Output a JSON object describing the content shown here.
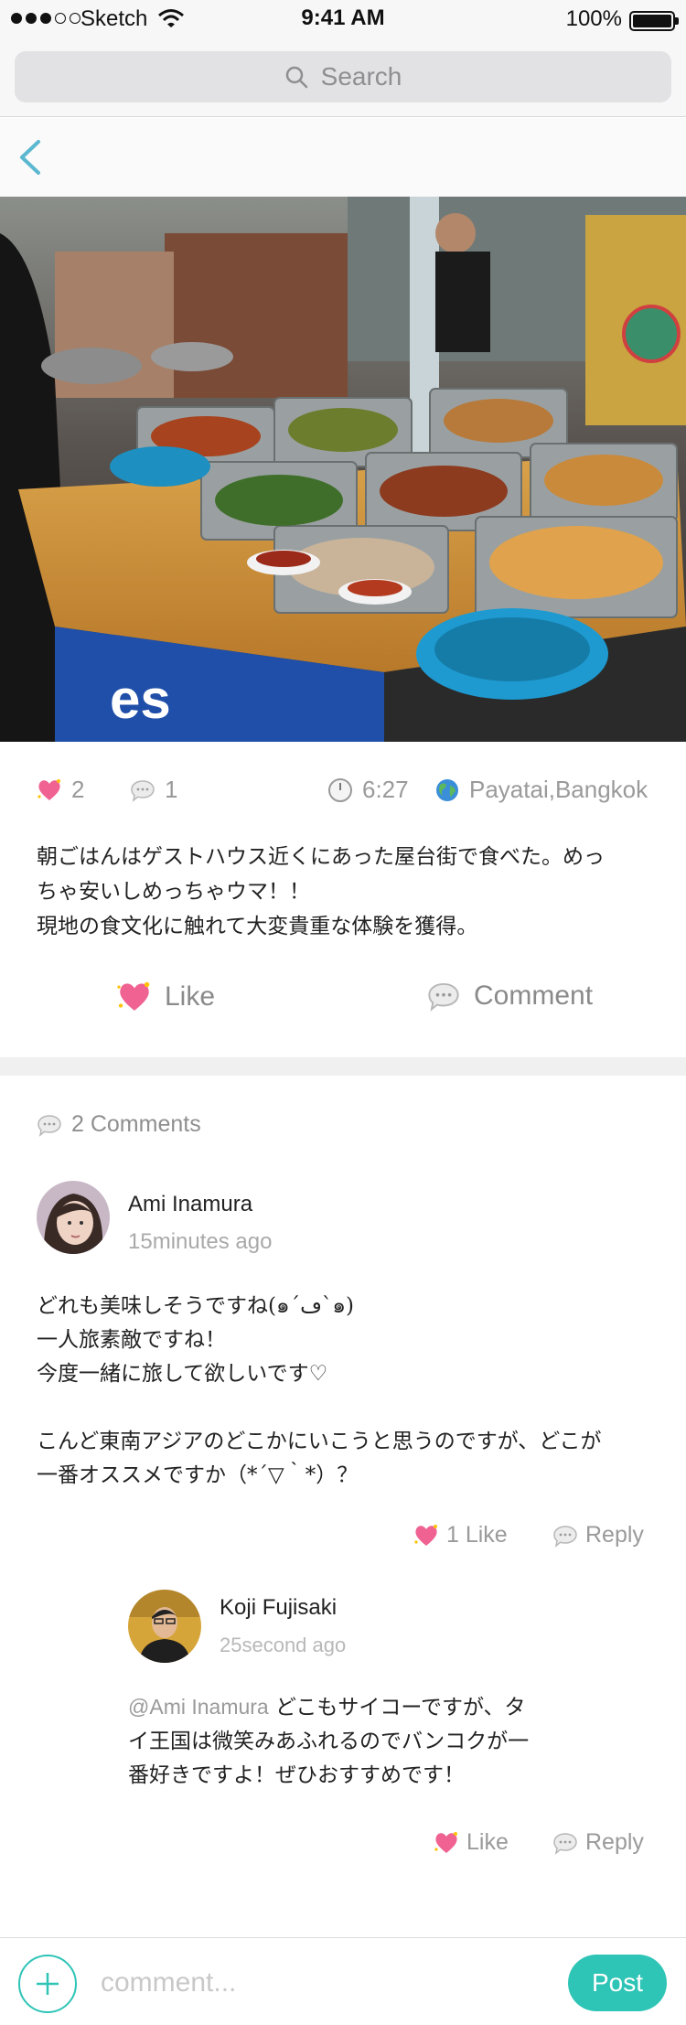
{
  "status_bar": {
    "carrier": "Sketch",
    "time": "9:41 AM",
    "battery": "100%"
  },
  "search": {
    "placeholder": "Search"
  },
  "nav": {
    "back_icon": "chevron-left-icon"
  },
  "post": {
    "likes_count": "2",
    "comments_count": "1",
    "time": "6:27",
    "location": "Payatai,Bangkok",
    "text": "朝ごはんはゲストハウス近くにあった屋台街で食べた。めっ\nちゃ安いしめっちゃウマ！！\n現地の食文化に触れて大変貴重な体験を獲得。",
    "like_label": "Like",
    "comment_label": "Comment"
  },
  "comments": {
    "header": "2 Comments",
    "items": [
      {
        "name": "Ami Inamura",
        "time_ago": "15minutes ago",
        "text": "どれも美味しそうですね(๑´ڡ`๑)\n一人旅素敵ですね！\n今度一緒に旅して欲しいです♡\n\nこんど東南アジアのどこかにいこうと思うのですが、どこが\n一番オススメですか（*´▽｀*）？",
        "like_label": "1 Like",
        "reply_label": "Reply"
      }
    ],
    "replies": [
      {
        "name": "Koji Fujisaki",
        "time_ago": "25second ago",
        "mention": "@Ami Inamura",
        "line1": " どこもサイコーですが、タ",
        "rest": "イ王国は微笑みあふれるのでバンコクが一\n番好きですよ！ぜひおすすめです！",
        "like_label": "Like",
        "reply_label": "Reply"
      }
    ]
  },
  "input_bar": {
    "placeholder": "comment...",
    "post_label": "Post"
  },
  "colors": {
    "accent": "#2ec4b6",
    "back_chevron": "#5bb8d0",
    "heart": "#f06292",
    "muted": "#9a9a9a"
  }
}
